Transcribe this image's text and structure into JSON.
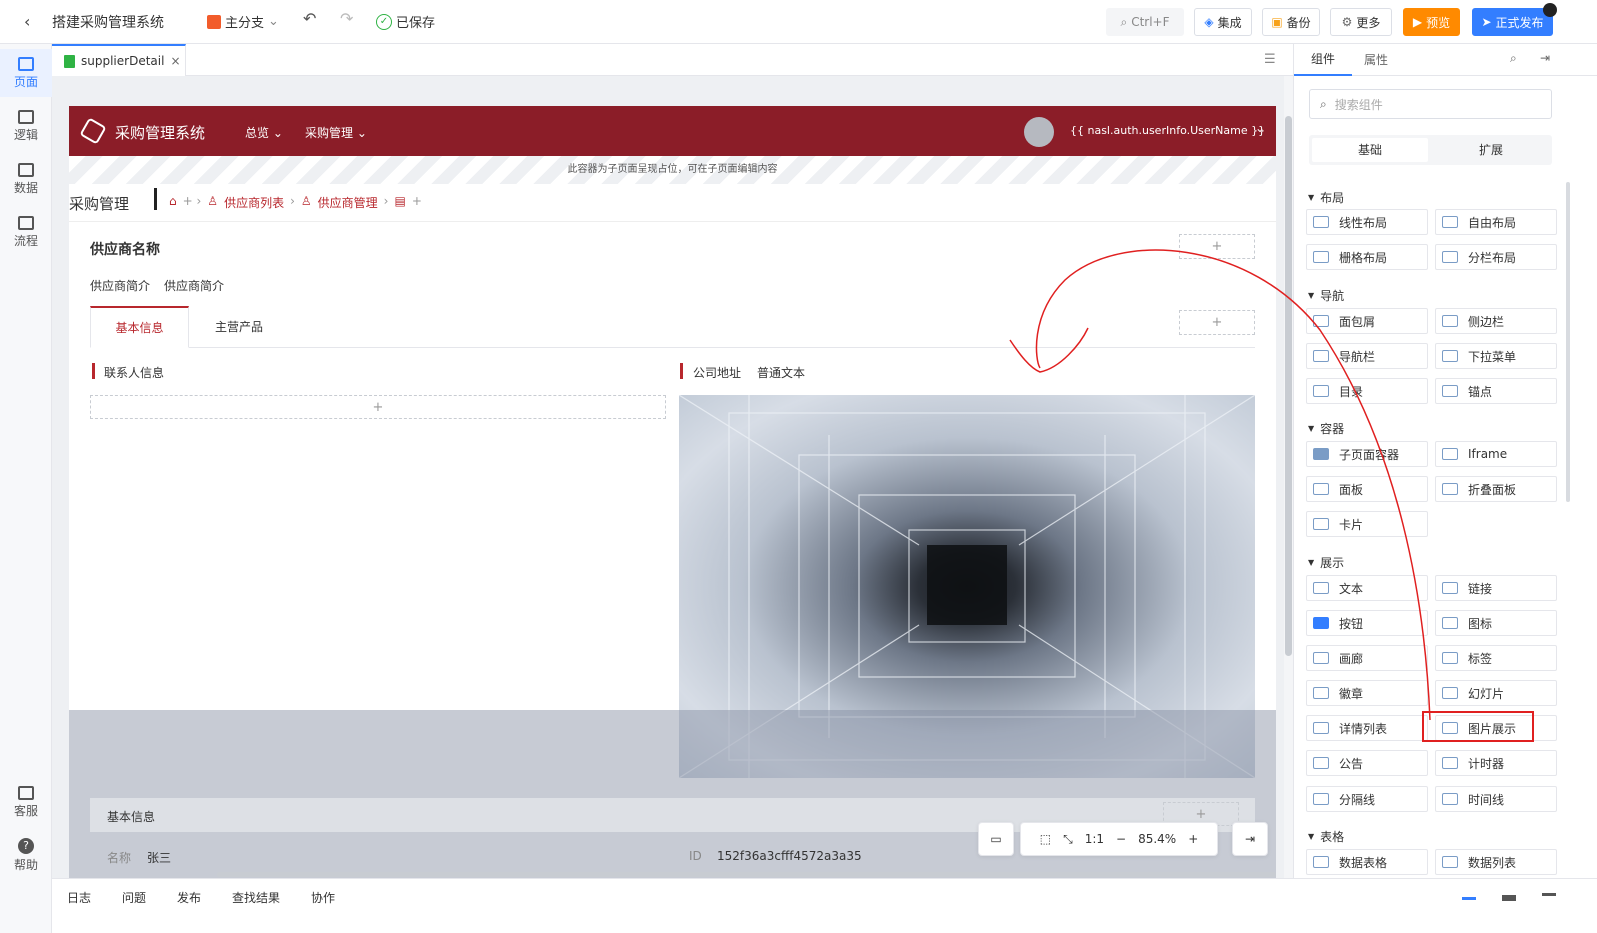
{
  "topbar": {
    "back_icon": "chevron-left-icon",
    "app_title": "搭建采购管理系统",
    "branch_label": "主分支",
    "saved_label": "已保存",
    "search_shortcut": "Ctrl+F",
    "integrate_label": "集成",
    "backup_label": "备份",
    "more_label": "更多",
    "preview_label": "预览",
    "publish_label": "正式发布"
  },
  "leftnav": {
    "items": [
      {
        "label": "页面"
      },
      {
        "label": "逻辑"
      },
      {
        "label": "数据"
      },
      {
        "label": "流程"
      }
    ],
    "bottom_items": [
      {
        "label": "客服"
      },
      {
        "label": "帮助"
      }
    ]
  },
  "filetab": {
    "name": "supplierDetail",
    "close": "×"
  },
  "designer": {
    "header": {
      "system_name": "采购管理系统",
      "menu": [
        "总览",
        "采购管理"
      ],
      "username": "{{ nasl.auth.userInfo.UserName }}"
    },
    "placeholder_note": "此容器为子页面呈现占位，可在子页面编辑内容",
    "page_title": "采购管理",
    "breadcrumb": [
      "供应商列表",
      "供应商管理"
    ],
    "supplier_name": "供应商名称",
    "intro": [
      "供应商简介",
      "供应商简介"
    ],
    "tabs": [
      "基本信息",
      "主营产品"
    ],
    "contact_title": "联系人信息",
    "address_label": "公司地址",
    "address_value": "普通文本",
    "plus": "+",
    "info_section": "基本信息",
    "field_name_label": "名称",
    "field_name_value": "张三",
    "field_id_label": "ID",
    "field_id_value": "152f36a3cfff4572a3a35"
  },
  "zoom": {
    "ratio": "1:1",
    "level": "85.4%",
    "minus": "−",
    "plus": "+"
  },
  "rpanel": {
    "tabs": [
      "组件",
      "属性"
    ],
    "search_placeholder": "搜索组件",
    "subtabs": [
      "基础",
      "扩展"
    ],
    "sections": [
      {
        "title": "布局",
        "items": [
          "线性布局",
          "自由布局",
          "栅格布局",
          "分栏布局"
        ]
      },
      {
        "title": "导航",
        "items": [
          "面包屑",
          "侧边栏",
          "导航栏",
          "下拉菜单",
          "目录",
          "锚点"
        ]
      },
      {
        "title": "容器",
        "items": [
          "子页面容器",
          "Iframe",
          "面板",
          "折叠面板",
          "卡片"
        ]
      },
      {
        "title": "展示",
        "items": [
          "文本",
          "链接",
          "按钮",
          "图标",
          "画廊",
          "标签",
          "徽章",
          "幻灯片",
          "详情列表",
          "图片展示",
          "公告",
          "计时器",
          "分隔线",
          "时间线"
        ]
      },
      {
        "title": "表格",
        "items": [
          "数据表格",
          "数据列表"
        ]
      }
    ]
  },
  "bottombar": {
    "tabs": [
      "日志",
      "问题",
      "发布",
      "查找结果",
      "协作"
    ]
  },
  "colors": {
    "brand_red": "#8b1d28",
    "accent_blue": "#337eff",
    "preview_orange": "#ff8a00",
    "annotation_red": "#e02020"
  }
}
